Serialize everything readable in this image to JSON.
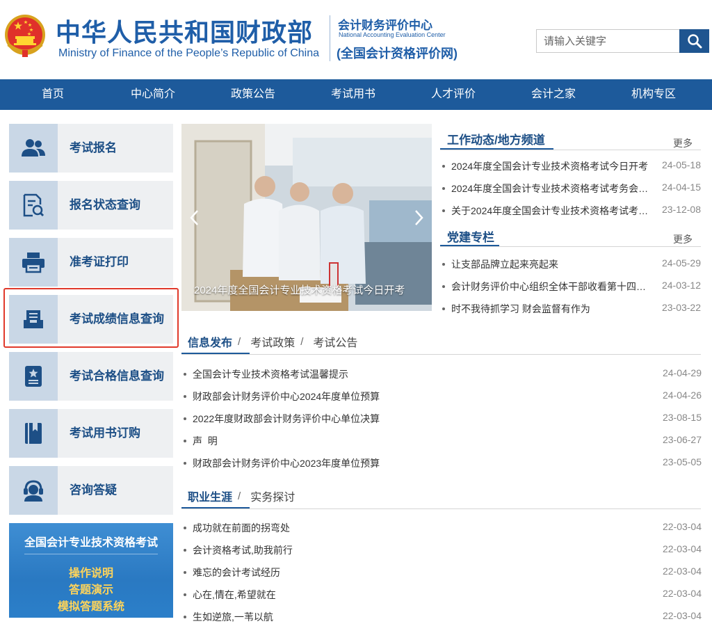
{
  "header": {
    "title_cn": "中华人民共和国财政部",
    "title_en": "Ministry of Finance of the People’s Republic of China",
    "center_cn": "会计财务评价中心",
    "center_en": "National Accounting Evaluation Center",
    "center_sub": "(全国会计资格评价网)",
    "search_placeholder": "请输入关键字",
    "brand_color": "#1f5ea8"
  },
  "nav": [
    "首页",
    "中心简介",
    "政策公告",
    "考试用书",
    "人才评价",
    "会计之家",
    "机构专区"
  ],
  "sidebar": {
    "items": [
      {
        "label": "考试报名",
        "icon": "users-icon"
      },
      {
        "label": "报名状态查询",
        "icon": "document-search-icon"
      },
      {
        "label": "准考证打印",
        "icon": "printer-icon"
      },
      {
        "label": "考试成绩信息查询",
        "icon": "inbox-icon"
      },
      {
        "label": "考试合格信息查询",
        "icon": "certificate-icon"
      },
      {
        "label": "考试用书订购",
        "icon": "book-icon"
      },
      {
        "label": "咨询答疑",
        "icon": "headset-icon"
      }
    ],
    "highlighted_index": 3,
    "banner": {
      "title": "全国会计专业技术资格考试",
      "links": [
        "操作说明",
        "答题演示",
        "模拟答题系统"
      ]
    }
  },
  "carousel": {
    "caption": "2024年度全国会计专业技术资格考试今日开考"
  },
  "work_news": {
    "title": "工作动态/地方频道",
    "more": "更多",
    "items": [
      {
        "text": "2024年度全国会计专业技术资格考试今日开考",
        "date": "24-05-18"
      },
      {
        "text": "2024年度全国会计专业技术资格考试考务会…",
        "date": "24-04-15"
      },
      {
        "text": "关于2024年度全国会计专业技术资格考试考…",
        "date": "23-12-08"
      }
    ]
  },
  "party": {
    "title": "党建专栏",
    "more": "更多",
    "items": [
      {
        "text": "让支部品牌立起来亮起来",
        "date": "24-05-29"
      },
      {
        "text": "会计财务评价中心组织全体干部收看第十四…",
        "date": "24-03-12"
      },
      {
        "text": "时不我待抓学习 财会监督有作为",
        "date": "23-03-22"
      }
    ]
  },
  "info": {
    "tabs": [
      "信息发布",
      "考试政策",
      "考试公告"
    ],
    "items": [
      {
        "text": "全国会计专业技术资格考试温馨提示",
        "date": "24-04-29"
      },
      {
        "text": "财政部会计财务评价中心2024年度单位预算",
        "date": "24-04-26"
      },
      {
        "text": "2022年度财政部会计财务评价中心单位决算",
        "date": "23-08-15"
      },
      {
        "text": "声  明",
        "date": "23-06-27"
      },
      {
        "text": "财政部会计财务评价中心2023年度单位预算",
        "date": "23-05-05"
      }
    ]
  },
  "career": {
    "tabs": [
      "职业生涯",
      "实务探讨"
    ],
    "items": [
      {
        "text": "成功就在前面的拐弯处",
        "date": "22-03-04"
      },
      {
        "text": "会计资格考试,助我前行",
        "date": "22-03-04"
      },
      {
        "text": "难忘的会计考试经历",
        "date": "22-03-04"
      },
      {
        "text": "心在,情在,希望就在",
        "date": "22-03-04"
      },
      {
        "text": "生如逆旅,一苇以航",
        "date": "22-03-04"
      }
    ]
  }
}
